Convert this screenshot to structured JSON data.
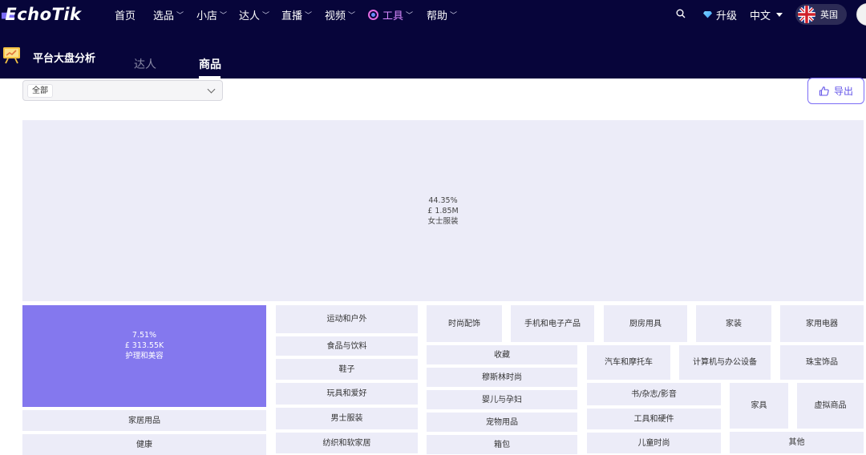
{
  "brand": {
    "logo_text": "EchoTik"
  },
  "nav": {
    "items": [
      {
        "label": "首页",
        "chevron": false
      },
      {
        "label": "选品",
        "chevron": true
      },
      {
        "label": "小店",
        "chevron": true
      },
      {
        "label": "达人",
        "chevron": true
      },
      {
        "label": "直播",
        "chevron": true
      },
      {
        "label": "视频",
        "chevron": true
      },
      {
        "label": "工具",
        "chevron": true
      },
      {
        "label": "帮助",
        "chevron": true
      }
    ],
    "upgrade_label": "升级",
    "language_label": "中文",
    "region_label": "英国"
  },
  "header": {
    "page_title": "平台大盘分析",
    "tabs": [
      {
        "label": "达人",
        "active": false
      },
      {
        "label": "商品",
        "active": true
      }
    ]
  },
  "filter": {
    "selected": "全部"
  },
  "toolbar": {
    "export_label": "导出"
  },
  "colors": {
    "nav_bg": "#07053a",
    "accent": "#7b6cf6",
    "tile": "#ececf8",
    "tile_active": "#8478ee"
  },
  "treemap": {
    "big": {
      "percent": "44.35%",
      "amount": "£ 1.85M",
      "label": "女士服装"
    },
    "active": {
      "percent": "7.51%",
      "amount": "£ 313.55K",
      "label": "护理和美容"
    },
    "tiles": [
      "家居用品",
      "健康",
      "运动和户外",
      "食品与饮料",
      "鞋子",
      "玩具和爱好",
      "男士服装",
      "纺织和软家居",
      "时尚配饰",
      "手机和电子产品",
      "厨房用具",
      "家装",
      "家用电器",
      "收藏",
      "穆斯林时尚",
      "婴儿与孕妇",
      "宠物用品",
      "箱包",
      "汽车和摩托车",
      "计算机与办公设备",
      "珠宝饰品",
      "书/杂志/影音",
      "工具和硬件",
      "儿童时尚",
      "家具",
      "虚拟商品",
      "其他"
    ]
  }
}
